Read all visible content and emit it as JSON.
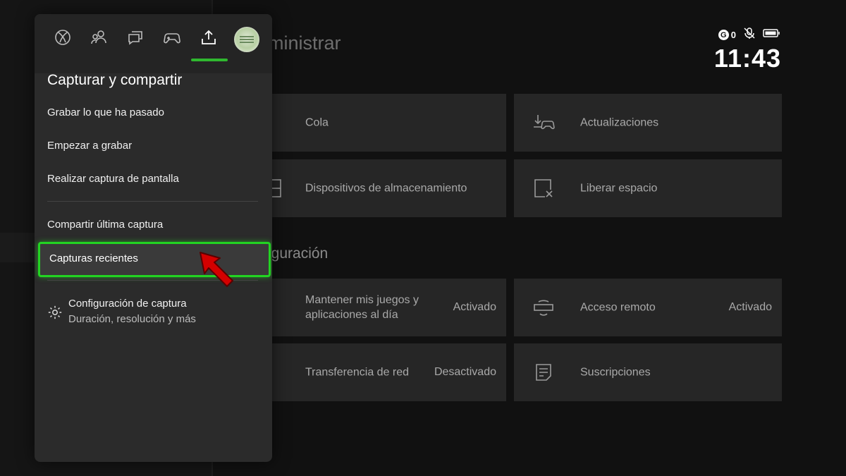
{
  "background": {
    "title": "ministrar",
    "section_heading": "iguración",
    "tiles": [
      {
        "label": "Cola",
        "status": "",
        "icon": "queue-icon"
      },
      {
        "label": "Actualizaciones",
        "status": "",
        "icon": "download-controller-icon"
      },
      {
        "label": "Dispositivos de almacenamiento",
        "status": "",
        "icon": "storage-icon"
      },
      {
        "label": "Liberar espacio",
        "status": "",
        "icon": "free-space-icon"
      },
      {
        "label": "Mantener mis juegos y aplicaciones al día",
        "status": "Activado",
        "icon": "update-icon"
      },
      {
        "label": "Acceso remoto",
        "status": "Activado",
        "icon": "remote-access-icon"
      },
      {
        "label": "Transferencia de red",
        "status": "Desactivado",
        "icon": "network-transfer-icon"
      },
      {
        "label": "Suscripciones",
        "status": "",
        "icon": "subscriptions-icon"
      }
    ]
  },
  "status_bar": {
    "gamerscore": "0",
    "clock": "11:43"
  },
  "guide": {
    "tabs": [
      "xbox-icon",
      "people-icon",
      "chat-icon",
      "controller-icon",
      "share-upload-icon",
      "profile-avatar"
    ],
    "active_tab": "share-upload-icon",
    "title": "Capturar y compartir",
    "items": [
      "Grabar lo que ha pasado",
      "Empezar a grabar",
      "Realizar captura de pantalla"
    ],
    "items2": [
      "Compartir última captura",
      "Capturas recientes"
    ],
    "settings": {
      "title": "Configuración de captura",
      "subtitle": "Duración, resolución y más"
    }
  },
  "colors": {
    "focus": "#22d422",
    "accent": "#2fb82f",
    "pointer": "#d40000"
  }
}
